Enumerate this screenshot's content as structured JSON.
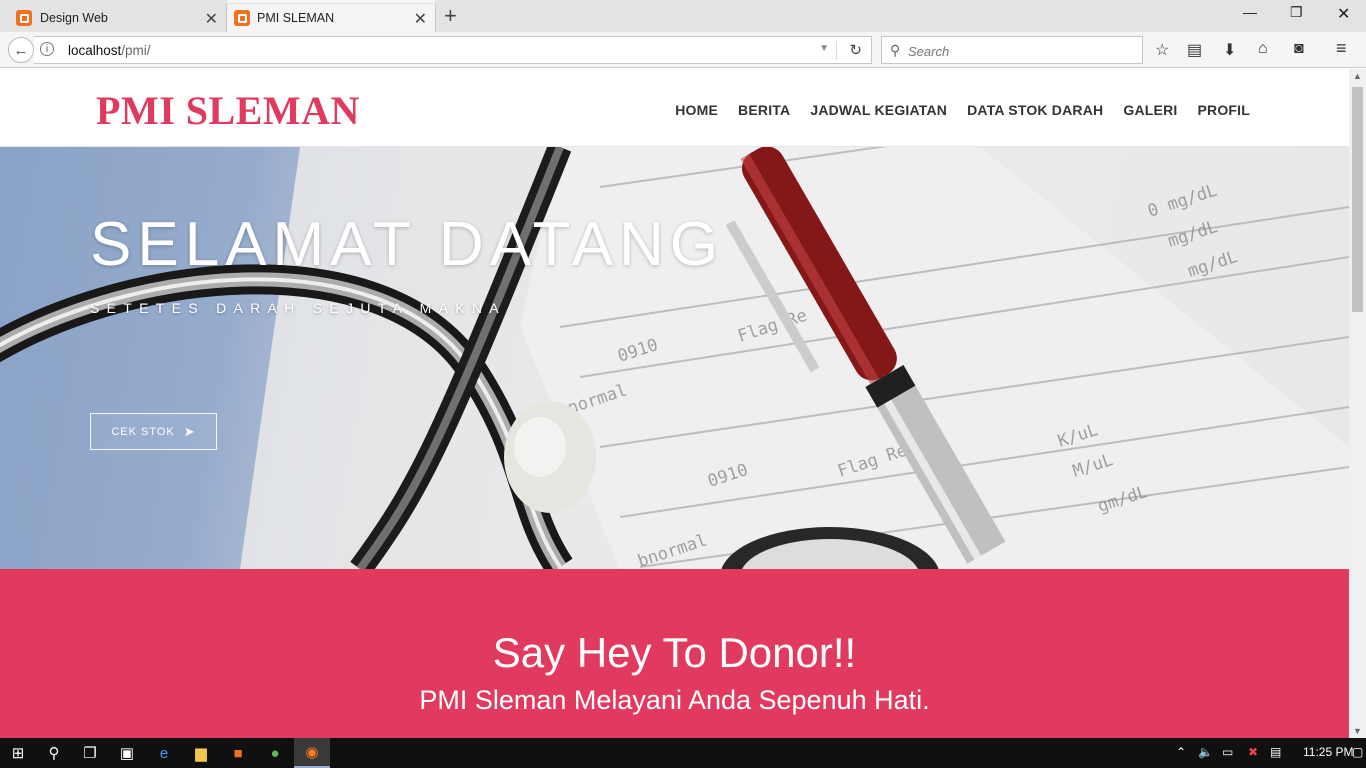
{
  "browser": {
    "tabs": [
      {
        "label": "Design Web",
        "active": false
      },
      {
        "label": "PMI SLEMAN",
        "active": true
      }
    ],
    "url_host": "localhost",
    "url_path": "/pmi/",
    "search_placeholder": "Search"
  },
  "site": {
    "logo": "PMI SLEMAN",
    "menu": [
      "HOME",
      "BERITA",
      "JADWAL KEGIATAN",
      "DATA STOK DARAH",
      "GALERI",
      "PROFIL"
    ],
    "hero_title": "SELAMAT DATANG",
    "hero_subtitle": "SETETES DARAH SEJUTA MAKNA",
    "cta_label": "CEK STOK",
    "donor_heading": "Say Hey To Donor!!",
    "donor_text": "PMI Sleman Melayani Anda Sepenuh Hati.",
    "colors": {
      "brand": "#e03b5e",
      "band": "#e23a5e"
    }
  },
  "taskbar": {
    "clock": "11:25 PM"
  }
}
